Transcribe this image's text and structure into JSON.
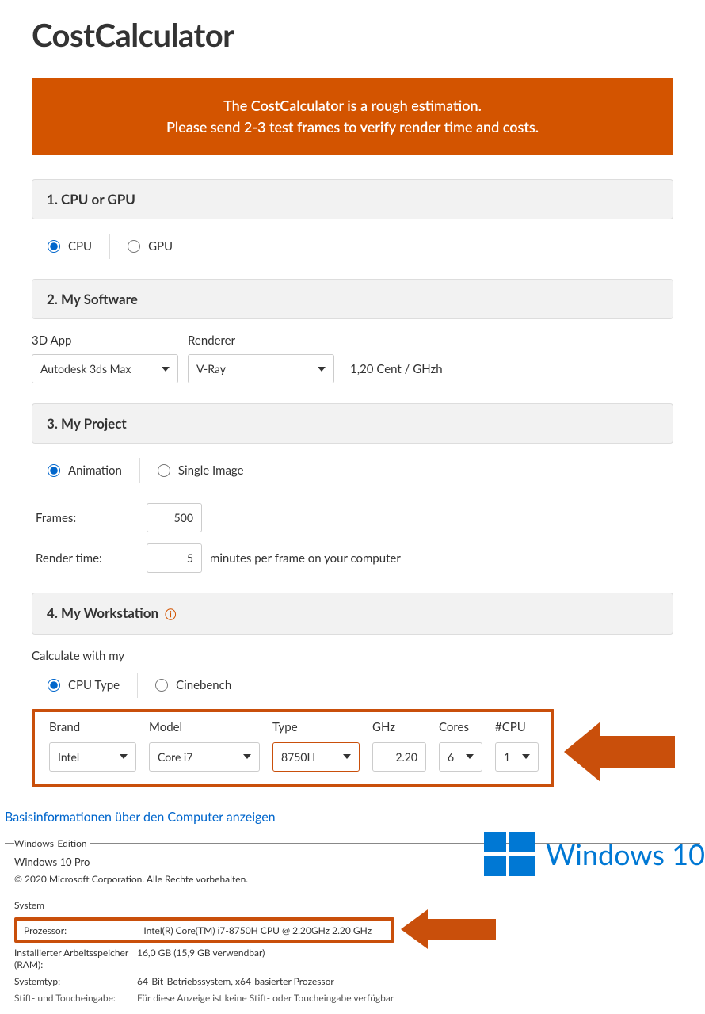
{
  "page_title": "CostCalculator",
  "banner": {
    "line1": "The CostCalculator is a rough estimation.",
    "line2": "Please send 2-3 test frames to verify render time and costs."
  },
  "sections": {
    "s1": {
      "title": "1. CPU or GPU",
      "options": {
        "cpu": "CPU",
        "gpu": "GPU"
      }
    },
    "s2": {
      "title": "2. My Software",
      "app_label": "3D App",
      "app_value": "Autodesk 3ds Max",
      "renderer_label": "Renderer",
      "renderer_value": "V-Ray",
      "price": "1,20 Cent / GHzh"
    },
    "s3": {
      "title": "3. My Project",
      "opt_animation": "Animation",
      "opt_single": "Single Image",
      "frames_label": "Frames:",
      "frames_value": "500",
      "rendertime_label": "Render time:",
      "rendertime_value": "5",
      "rendertime_suffix": "minutes per frame on your computer"
    },
    "s4": {
      "title": "4. My Workstation",
      "info_icon": "ⓘ",
      "calc_with": "Calculate with my",
      "opt_cputype": "CPU Type",
      "opt_cinebench": "Cinebench",
      "brand_label": "Brand",
      "brand_value": "Intel",
      "model_label": "Model",
      "model_value": "Core i7",
      "type_label": "Type",
      "type_value": "8750H",
      "ghz_label": "GHz",
      "ghz_value": "2.20",
      "cores_label": "Cores",
      "cores_value": "6",
      "ncpu_label": "#CPU",
      "ncpu_value": "1"
    }
  },
  "sysinfo": {
    "title": "Basisinformationen über den Computer anzeigen",
    "edition_legend": "Windows-Edition",
    "edition_name": "Windows 10 Pro",
    "copyright": "© 2020 Microsoft Corporation. Alle Rechte vorbehalten.",
    "win_logo_text": "Windows 10",
    "system_legend": "System",
    "processor_label": "Prozessor:",
    "processor_value": "Intel(R) Core(TM) i7-8750H CPU @ 2.20GHz   2.20 GHz",
    "ram_label": "Installierter Arbeitsspeicher (RAM):",
    "ram_value": "16,0 GB (15,9 GB verwendbar)",
    "systype_label": "Systemtyp:",
    "systype_value": "64-Bit-Betriebssystem, x64-basierter Prozessor",
    "touch_label": "Stift- und Toucheingabe:",
    "touch_value": "Für diese Anzeige ist keine Stift- oder Toucheingabe verfügbar"
  }
}
